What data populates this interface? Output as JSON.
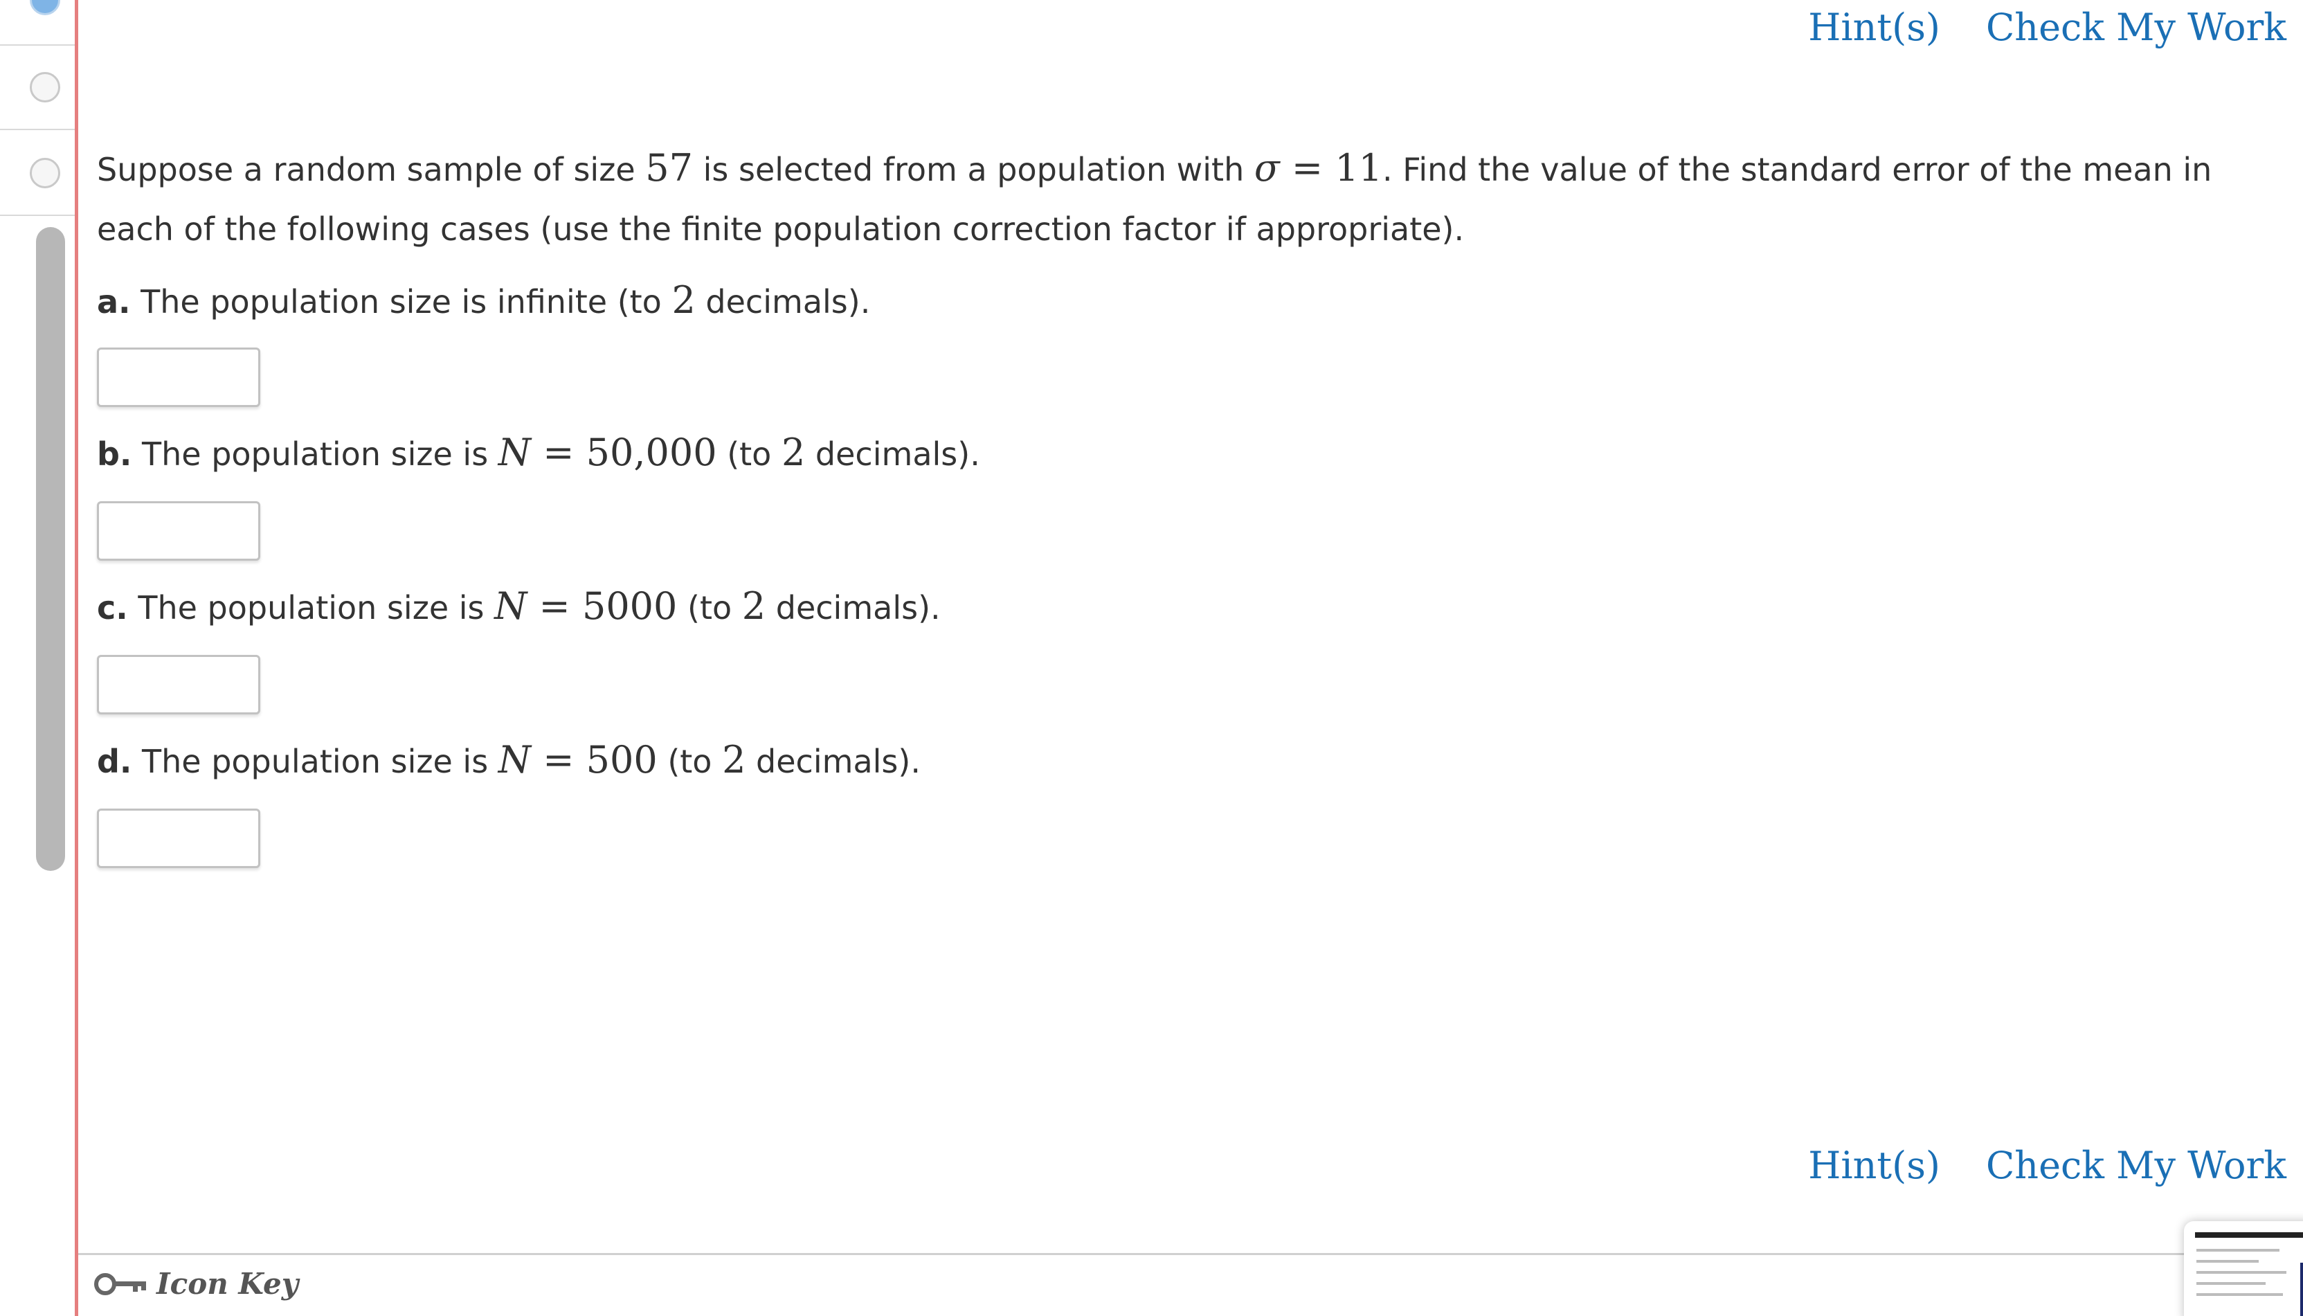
{
  "actions": {
    "hints_label": "Hint(s)",
    "check_label": "Check My Work"
  },
  "question": {
    "intro_1": "Suppose a random sample of size ",
    "sample_size": "57",
    "intro_2": " is selected from a population with ",
    "sigma_symbol": "σ",
    "equals": " = ",
    "sigma_value": "11",
    "intro_3": ". Find the value of the standard error of the mean in",
    "intro_4": "each of the following cases (use the finite population correction factor if appropriate).",
    "parts": [
      {
        "letter": "a.",
        "text_1": " The population size is infinite (to ",
        "decimals": "2",
        "text_2": " decimals).",
        "value": ""
      },
      {
        "letter": "b.",
        "text_1": " The population size is ",
        "var": "N",
        "equals": " = ",
        "n_value": "50,000",
        "text_2": " (to ",
        "decimals": "2",
        "text_3": " decimals).",
        "value": ""
      },
      {
        "letter": "c.",
        "text_1": " The population size is ",
        "var": "N",
        "equals": " = ",
        "n_value": "5000",
        "text_2": " (to ",
        "decimals": "2",
        "text_3": " decimals).",
        "value": ""
      },
      {
        "letter": "d.",
        "text_1": " The population size is ",
        "var": "N",
        "equals": " = ",
        "n_value": "500",
        "text_2": " (to ",
        "decimals": "2",
        "text_3": " decimals).",
        "value": ""
      }
    ]
  },
  "footer": {
    "icon_key_label": "Icon Key",
    "key_icon": "key-icon"
  },
  "colors": {
    "link": "#1a6fb5",
    "divider": "#e57f7f",
    "text": "#333333"
  }
}
